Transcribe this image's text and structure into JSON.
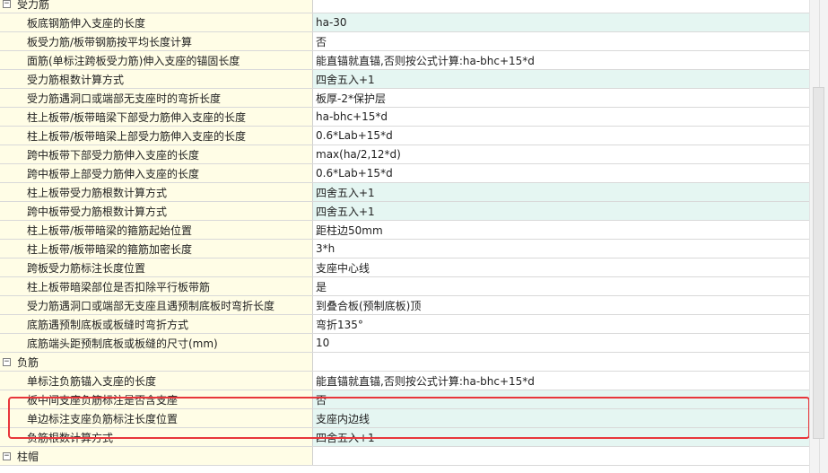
{
  "groups": [
    {
      "label": "受力筋",
      "toggle": "−",
      "rows": [
        {
          "name": "板底钢筋伸入支座的长度",
          "value": "ha-30",
          "highlight": true
        },
        {
          "name": "板受力筋/板带钢筋按平均长度计算",
          "value": "否",
          "highlight": false
        },
        {
          "name": "面筋(单标注跨板受力筋)伸入支座的锚固长度",
          "value": "能直锚就直锚,否则按公式计算:ha-bhc+15*d",
          "highlight": false
        },
        {
          "name": "受力筋根数计算方式",
          "value": "四舍五入+1",
          "highlight": true
        },
        {
          "name": "受力筋遇洞口或端部无支座时的弯折长度",
          "value": "板厚-2*保护层",
          "highlight": false
        },
        {
          "name": "柱上板带/板带暗梁下部受力筋伸入支座的长度",
          "value": "ha-bhc+15*d",
          "highlight": false
        },
        {
          "name": "柱上板带/板带暗梁上部受力筋伸入支座的长度",
          "value": "0.6*Lab+15*d",
          "highlight": false
        },
        {
          "name": "跨中板带下部受力筋伸入支座的长度",
          "value": "max(ha/2,12*d)",
          "highlight": false
        },
        {
          "name": "跨中板带上部受力筋伸入支座的长度",
          "value": "0.6*Lab+15*d",
          "highlight": false
        },
        {
          "name": "柱上板带受力筋根数计算方式",
          "value": "四舍五入+1",
          "highlight": true
        },
        {
          "name": "跨中板带受力筋根数计算方式",
          "value": "四舍五入+1",
          "highlight": true
        },
        {
          "name": "柱上板带/板带暗梁的箍筋起始位置",
          "value": "距柱边50mm",
          "highlight": false
        },
        {
          "name": "柱上板带/板带暗梁的箍筋加密长度",
          "value": "3*h",
          "highlight": false
        },
        {
          "name": "跨板受力筋标注长度位置",
          "value": "支座中心线",
          "highlight": false
        },
        {
          "name": "柱上板带暗梁部位是否扣除平行板带筋",
          "value": "是",
          "highlight": false
        },
        {
          "name": "受力筋遇洞口或端部无支座且遇预制底板时弯折长度",
          "value": "到叠合板(预制底板)顶",
          "highlight": false
        },
        {
          "name": "底筋遇预制底板或板缝时弯折方式",
          "value": "弯折135°",
          "highlight": false
        },
        {
          "name": "底筋端头距预制底板或板缝的尺寸(mm)",
          "value": "10",
          "highlight": false
        }
      ]
    },
    {
      "label": "负筋",
      "toggle": "−",
      "rows": [
        {
          "name": "单标注负筋锚入支座的长度",
          "value": "能直锚就直锚,否则按公式计算:ha-bhc+15*d",
          "highlight": false
        },
        {
          "name": "板中间支座负筋标注是否含支座",
          "value": "否",
          "highlight": true
        },
        {
          "name": "单边标注支座负筋标注长度位置",
          "value": "支座内边线",
          "highlight": true
        },
        {
          "name": "负筋根数计算方式",
          "value": "四舍五入+1",
          "highlight": true
        }
      ]
    },
    {
      "label": "柱帽",
      "toggle": "−",
      "rows": []
    }
  ],
  "colors": {
    "name_bg": "#fffde6",
    "value_highlight_bg": "#e5f6f2",
    "selection_border": "#e8363b"
  }
}
